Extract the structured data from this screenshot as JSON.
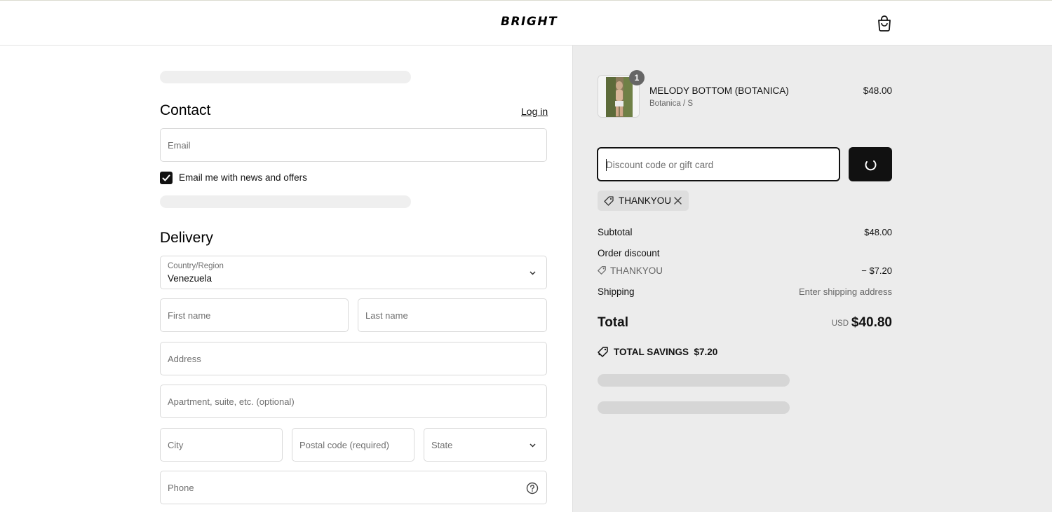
{
  "header": {
    "logo": "BRIGHT",
    "cart_icon": "shopping-bag-icon"
  },
  "contact": {
    "title": "Contact",
    "login_link": "Log in",
    "email_placeholder": "Email",
    "newsletter_label": "Email me with news and offers",
    "newsletter_checked": true
  },
  "delivery": {
    "title": "Delivery",
    "country_label": "Country/Region",
    "country_value": "Venezuela",
    "first_name_placeholder": "First name",
    "last_name_placeholder": "Last name",
    "address_placeholder": "Address",
    "apartment_placeholder": "Apartment, suite, etc. (optional)",
    "city_placeholder": "City",
    "postal_placeholder": "Postal code (required)",
    "state_placeholder": "State",
    "phone_placeholder": "Phone"
  },
  "order": {
    "item": {
      "name": "MELODY BOTTOM (BOTANICA)",
      "variant": "Botanica / S",
      "price": "$48.00",
      "quantity": "1"
    },
    "discount_placeholder": "Discount code or gift card",
    "applied_code": "THANKYOU",
    "subtotal_label": "Subtotal",
    "subtotal_value": "$48.00",
    "order_discount_label": "Order discount",
    "discount_code": "THANKYOU",
    "discount_value": "− $7.20",
    "shipping_label": "Shipping",
    "shipping_value": "Enter shipping address",
    "total_label": "Total",
    "currency": "USD",
    "total_value": "$40.80",
    "savings_label": "TOTAL SAVINGS",
    "savings_value": "$7.20"
  },
  "colors": {
    "accent": "#111111",
    "summary_bg": "#ececec"
  }
}
